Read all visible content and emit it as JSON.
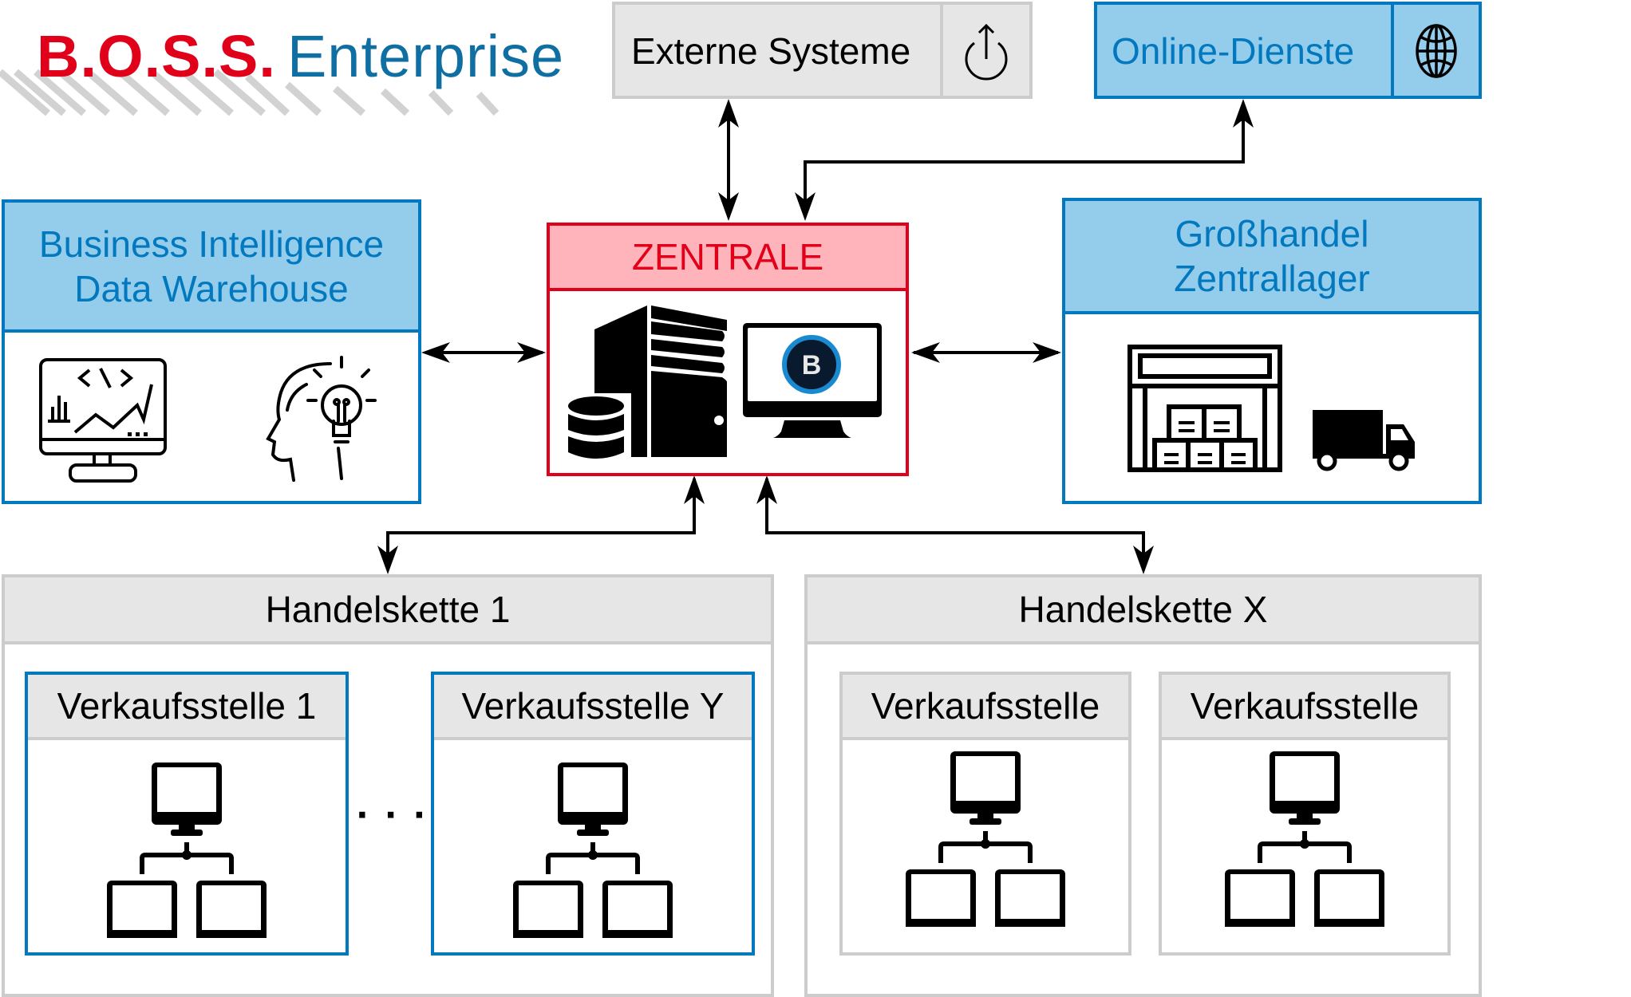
{
  "logo": {
    "brand": "B.O.S.S.",
    "product": "Enterprise"
  },
  "nodes": {
    "externe": {
      "label": "Externe Systeme",
      "icon": "power-icon"
    },
    "online": {
      "label": "Online-Dienste",
      "icon": "globe-icon"
    },
    "bi": {
      "line1": "Business Intelligence",
      "line2": "Data Warehouse",
      "icons": [
        "analytics-monitor-icon",
        "head-lightbulb-icon"
      ]
    },
    "zentrale": {
      "label": "ZENTRALE",
      "icons": [
        "database-icon",
        "server-tower-icon",
        "boss-monitor-icon"
      ],
      "badge": "B"
    },
    "grosshandel": {
      "line1": "Großhandel",
      "line2": "Zentrallager",
      "icons": [
        "warehouse-icon",
        "truck-icon"
      ]
    },
    "handelskette1": {
      "label": "Handelskette 1",
      "stores": [
        {
          "label": "Verkaufsstelle 1"
        },
        {
          "label": "Verkaufsstelle Y"
        }
      ],
      "ellipsis": "· · ·"
    },
    "handelsketteX": {
      "label": "Handelskette X",
      "stores": [
        {
          "label": "Verkaufsstelle"
        },
        {
          "label": "Verkaufsstelle"
        }
      ]
    }
  },
  "connections": [
    {
      "from": "zentrale",
      "to": "externe",
      "type": "bidirectional"
    },
    {
      "from": "zentrale",
      "to": "online",
      "type": "bidirectional"
    },
    {
      "from": "zentrale",
      "to": "bi",
      "type": "bidirectional"
    },
    {
      "from": "zentrale",
      "to": "grosshandel",
      "type": "bidirectional"
    },
    {
      "from": "zentrale",
      "to": "handelskette1",
      "type": "bidirectional"
    },
    {
      "from": "zentrale",
      "to": "handelsketteX",
      "type": "bidirectional"
    }
  ],
  "colors": {
    "red": "#E1001A",
    "pink": "#FFB3BB",
    "blue": "#0278BE",
    "light_blue": "#94CCEC",
    "gray_fill": "#E6E6E6",
    "gray_border": "#CCCCCC"
  }
}
